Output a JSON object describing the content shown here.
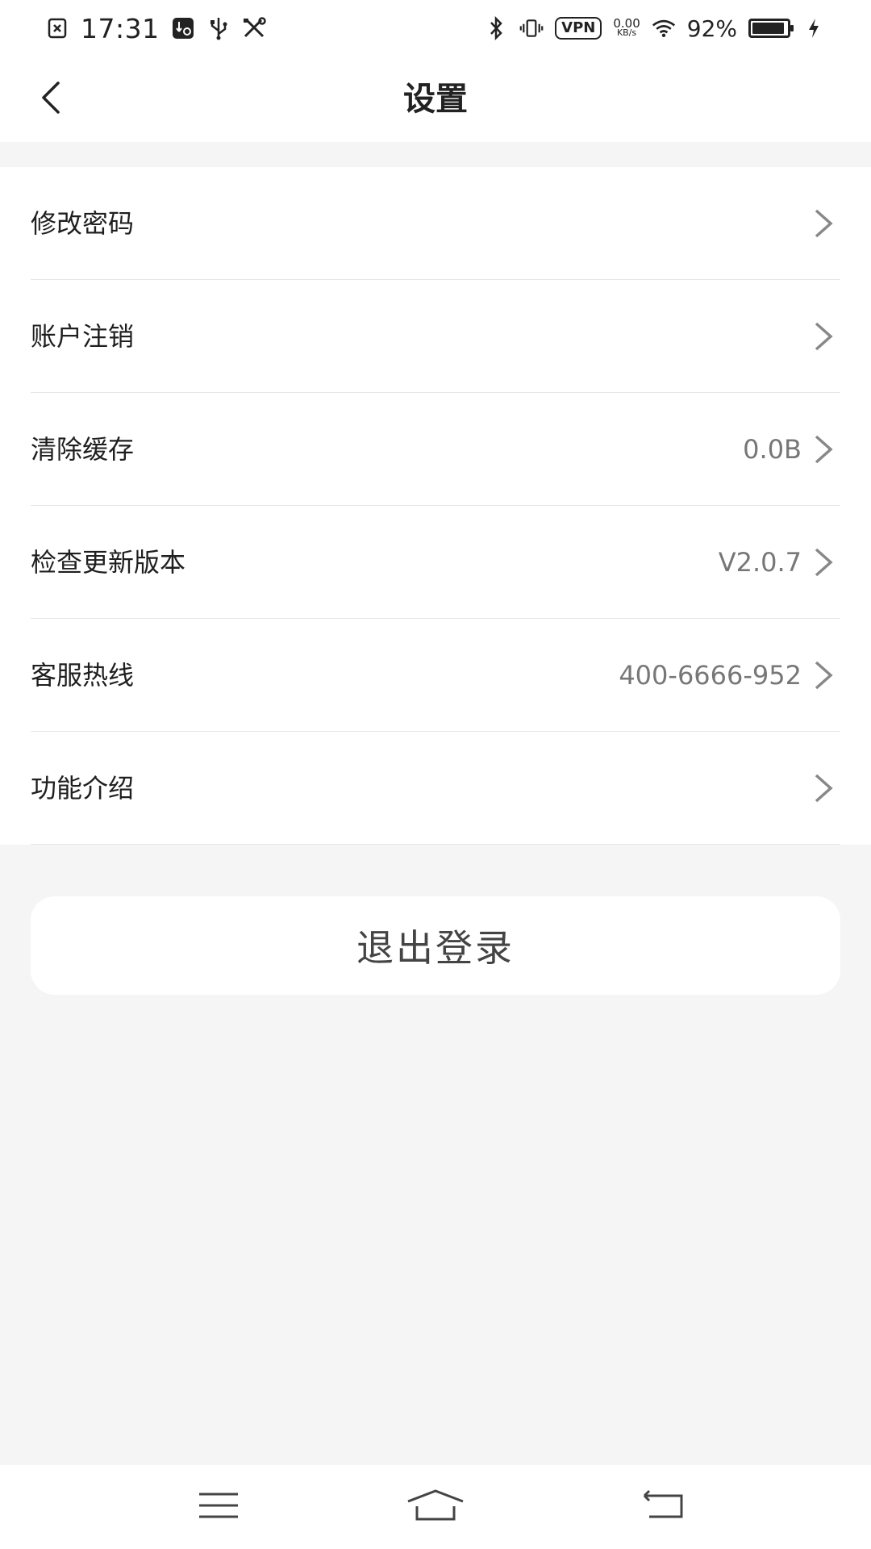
{
  "status_bar": {
    "time": "17:31",
    "vpn": "VPN",
    "net_speed": "0.00",
    "net_speed_unit": "KB/s",
    "battery_percent_text": "92%",
    "battery_level": 0.92,
    "left_icons": [
      "notification-x-icon",
      "usb-debug-icon",
      "usb-icon",
      "tools-icon"
    ],
    "right_icons": [
      "bluetooth-icon",
      "vibrate-icon",
      "wifi-icon",
      "battery-icon",
      "charging-icon"
    ]
  },
  "header": {
    "title": "设置",
    "back_icon": "chevron-left-icon"
  },
  "settings": {
    "items": [
      {
        "label": "修改密码",
        "value": ""
      },
      {
        "label": "账户注销",
        "value": ""
      },
      {
        "label": "清除缓存",
        "value": "0.0B"
      },
      {
        "label": "检查更新版本",
        "value": "V2.0.7"
      },
      {
        "label": "客服热线",
        "value": "400-6666-952"
      },
      {
        "label": "功能介绍",
        "value": ""
      }
    ]
  },
  "logout": {
    "label": "退出登录"
  },
  "system_nav": {
    "icons": [
      "menu-icon",
      "home-icon",
      "back-icon"
    ]
  },
  "colors": {
    "background": "#f5f5f5",
    "card": "#ffffff",
    "text_primary": "#1f1f1f",
    "text_secondary": "#777777",
    "divider": "#e6e6e6"
  }
}
